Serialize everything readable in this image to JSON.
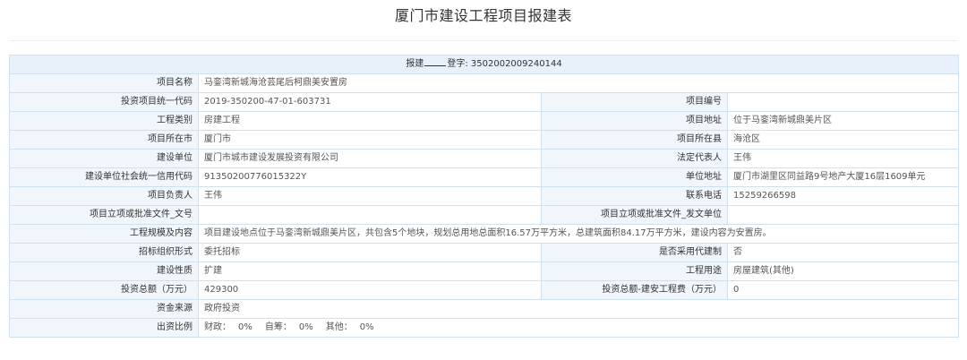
{
  "title": "厦门市建设工程项目报建表",
  "header_row": {
    "prefix": "报建",
    "suffix": "登字: 3502002009240144"
  },
  "rows": {
    "project_name": {
      "label": "项目名称",
      "value": "马銮湾新城海沧芸尾后柯鼎美安置房"
    },
    "invest_code": {
      "label": "投资项目统一代码",
      "value": "2019-350200-47-01-603731"
    },
    "project_no": {
      "label": "项目编号",
      "value": ""
    },
    "project_type": {
      "label": "工程类别",
      "value": "房建工程"
    },
    "project_address": {
      "label": "项目地址",
      "value": "位于马銮湾新城鼎美片区"
    },
    "city": {
      "label": "项目所在市",
      "value": "厦门市"
    },
    "county": {
      "label": "项目所在县",
      "value": "海沧区"
    },
    "builder": {
      "label": "建设单位",
      "value": "厦门市城市建设发展投资有限公司"
    },
    "legal_rep": {
      "label": "法定代表人",
      "value": "王伟"
    },
    "credit_code": {
      "label": "建设单位社会统一信用代码",
      "value": "91350200776015322Y"
    },
    "unit_address": {
      "label": "单位地址",
      "value": "厦门市湖里区同益路9号地产大厦16层1609单元"
    },
    "project_manager": {
      "label": "项目负责人",
      "value": "王伟"
    },
    "phone": {
      "label": "联系电话",
      "value": "15259266598"
    },
    "approval_doc_no": {
      "label": "项目立项或批准文件_文号",
      "value": ""
    },
    "approval_doc_unit": {
      "label": "项目立项或批准文件_发文单位",
      "value": ""
    },
    "scale_content": {
      "label": "工程规模及内容",
      "value": "项目建设地点位于马銮湾新城鼎美片区，共包含5个地块，规划总用地总面积16.57万平方米，总建筑面积84.17万平方米，建设内容为安置房。"
    },
    "bid_form": {
      "label": "招标组织形式",
      "value": "委托招标"
    },
    "agent_build": {
      "label": "是否采用代建制",
      "value": "否"
    },
    "nature": {
      "label": "建设性质",
      "value": "扩建"
    },
    "usage": {
      "label": "工程用途",
      "value": "房屋建筑(其他)"
    },
    "total_invest": {
      "label": "投资总额（万元）",
      "value": "429300"
    },
    "install_cost": {
      "label": "投资总额-建安工程费（万元）",
      "value": "0"
    },
    "fund_source": {
      "label": "资金来源",
      "value": "政府投资"
    },
    "fund_ratio": {
      "label": "出资比例",
      "gov_label": "财政：",
      "gov_value": "0%",
      "self_label": "自筹：",
      "self_value": "0%",
      "other_label": "其他：",
      "other_value": "0%"
    }
  }
}
